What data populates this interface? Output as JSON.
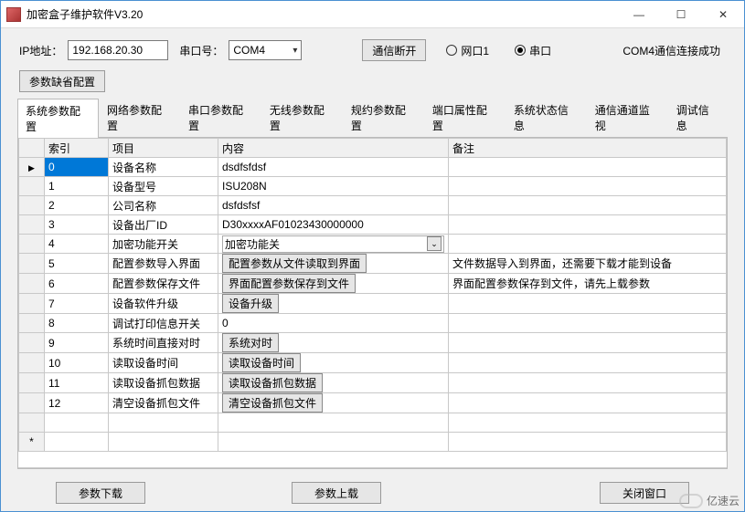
{
  "window": {
    "title": "加密盒子维护软件V3.20"
  },
  "toolbar": {
    "ip_label": "IP地址：",
    "ip_value": "192.168.20.30",
    "com_label": "串口号：",
    "com_value": "COM4",
    "disconnect_btn": "通信断开",
    "radio_net": "网口1",
    "radio_serial": "串口",
    "status": "COM4通信连接成功",
    "default_cfg_btn": "参数缺省配置"
  },
  "tabs": [
    "系统参数配置",
    "网络参数配置",
    "串口参数配置",
    "无线参数配置",
    "规约参数配置",
    "端口属性配置",
    "系统状态信息",
    "通信通道监视",
    "调试信息"
  ],
  "columns": {
    "index": "索引",
    "item": "项目",
    "content": "内容",
    "remark": "备注"
  },
  "rows": [
    {
      "idx": "0",
      "item": "设备名称",
      "content": "dsdfsfdsf",
      "remark": "",
      "sel": true
    },
    {
      "idx": "1",
      "item": "设备型号",
      "content": "ISU208N",
      "remark": ""
    },
    {
      "idx": "2",
      "item": "公司名称",
      "content": "dsfdsfsf",
      "remark": ""
    },
    {
      "idx": "3",
      "item": "设备出厂ID",
      "content": "D30xxxxAF01023430000000",
      "remark": ""
    },
    {
      "idx": "4",
      "item": "加密功能开关",
      "content": "加密功能关",
      "remark": "",
      "dropdown": true
    },
    {
      "idx": "5",
      "item": "配置参数导入界面",
      "content": "配置参数从文件读取到界面",
      "remark": "文件数据导入到界面，还需要下载才能到设备",
      "btn": true
    },
    {
      "idx": "6",
      "item": "配置参数保存文件",
      "content": "界面配置参数保存到文件",
      "remark": "界面配置参数保存到文件，请先上载参数",
      "btn": true
    },
    {
      "idx": "7",
      "item": "设备软件升级",
      "content": "设备升级",
      "remark": "",
      "btn": true
    },
    {
      "idx": "8",
      "item": "调试打印信息开关",
      "content": "0",
      "remark": ""
    },
    {
      "idx": "9",
      "item": "系统时间直接对时",
      "content": "系统对时",
      "remark": "",
      "btn": true
    },
    {
      "idx": "10",
      "item": "读取设备时间",
      "content": "读取设备时间",
      "remark": "",
      "btn": true
    },
    {
      "idx": "11",
      "item": "读取设备抓包数据",
      "content": "读取设备抓包数据",
      "remark": "",
      "btn": true
    },
    {
      "idx": "12",
      "item": "清空设备抓包文件",
      "content": "清空设备抓包文件",
      "remark": "",
      "btn": true
    }
  ],
  "footer": {
    "download": "参数下载",
    "upload": "参数上载",
    "close": "关闭窗口"
  },
  "watermark": "亿速云"
}
